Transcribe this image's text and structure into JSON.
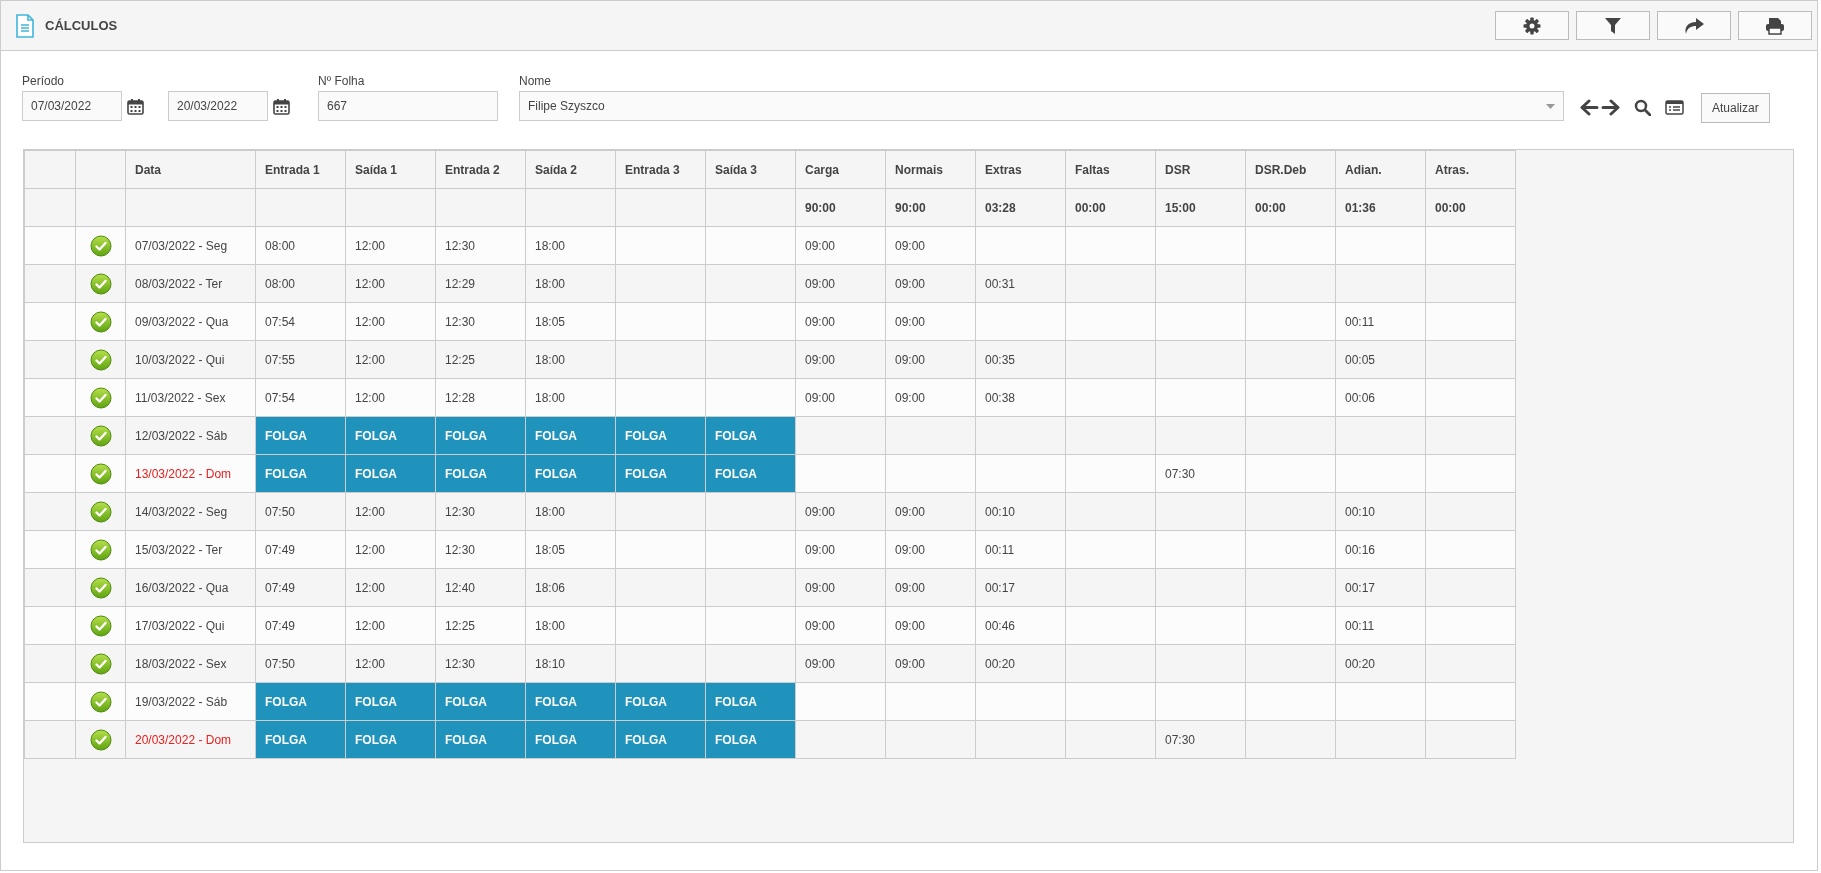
{
  "header": {
    "title": "CÁLCULOS"
  },
  "filters": {
    "period_label": "Período",
    "start_date": "07/03/2022",
    "end_date": "20/03/2022",
    "sheet_label": "Nº Folha",
    "sheet_number": "667",
    "name_label": "Nome",
    "name": "Filipe Szyszco",
    "refresh_button": "Atualizar"
  },
  "table": {
    "columns": [
      "Data",
      "Entrada 1",
      "Saída 1",
      "Entrada 2",
      "Saída 2",
      "Entrada 3",
      "Saída 3",
      "Carga",
      "Normais",
      "Extras",
      "Faltas",
      "DSR",
      "DSR.Deb",
      "Adian.",
      "Atras."
    ],
    "totals": [
      "90:00",
      "90:00",
      "03:28",
      "00:00",
      "15:00",
      "00:00",
      "01:36",
      "00:00"
    ],
    "rows": [
      {
        "date": "07/03/2022 - Seg",
        "sunday": false,
        "kind": "work",
        "punches": [
          "08:00",
          "12:00",
          "12:30",
          "18:00"
        ],
        "values": {
          "carga": "09:00",
          "normais": "09:00"
        }
      },
      {
        "date": "08/03/2022 - Ter",
        "sunday": false,
        "kind": "work",
        "punches": [
          "08:00",
          "12:00",
          "12:29",
          "18:00"
        ],
        "values": {
          "carga": "09:00",
          "normais": "09:00",
          "extras": "00:31"
        }
      },
      {
        "date": "09/03/2022 - Qua",
        "sunday": false,
        "kind": "work",
        "punches": [
          "07:54",
          "12:00",
          "12:30",
          "18:05"
        ],
        "values": {
          "carga": "09:00",
          "normais": "09:00",
          "adian": "00:11"
        }
      },
      {
        "date": "10/03/2022 - Qui",
        "sunday": false,
        "kind": "work",
        "punches": [
          "07:55",
          "12:00",
          "12:25",
          "18:00"
        ],
        "values": {
          "carga": "09:00",
          "normais": "09:00",
          "extras": "00:35",
          "adian": "00:05"
        }
      },
      {
        "date": "11/03/2022 - Sex",
        "sunday": false,
        "kind": "work",
        "punches": [
          "07:54",
          "12:00",
          "12:28",
          "18:00"
        ],
        "values": {
          "carga": "09:00",
          "normais": "09:00",
          "extras": "00:38",
          "adian": "00:06"
        }
      },
      {
        "date": "12/03/2022 - Sáb",
        "sunday": false,
        "kind": "day_off",
        "punches": [
          "FOLGA",
          "FOLGA",
          "FOLGA",
          "FOLGA",
          "FOLGA",
          "FOLGA"
        ],
        "values": {}
      },
      {
        "date": "13/03/2022 - Dom",
        "sunday": true,
        "kind": "day_off",
        "punches": [
          "FOLGA",
          "FOLGA",
          "FOLGA",
          "FOLGA",
          "FOLGA",
          "FOLGA"
        ],
        "values": {
          "dsr": "07:30"
        }
      },
      {
        "date": "14/03/2022 - Seg",
        "sunday": false,
        "kind": "work",
        "punches": [
          "07:50",
          "12:00",
          "12:30",
          "18:00"
        ],
        "values": {
          "carga": "09:00",
          "normais": "09:00",
          "extras": "00:10",
          "adian": "00:10"
        }
      },
      {
        "date": "15/03/2022 - Ter",
        "sunday": false,
        "kind": "work",
        "punches": [
          "07:49",
          "12:00",
          "12:30",
          "18:05"
        ],
        "values": {
          "carga": "09:00",
          "normais": "09:00",
          "extras": "00:11",
          "adian": "00:16"
        }
      },
      {
        "date": "16/03/2022 - Qua",
        "sunday": false,
        "kind": "work",
        "punches": [
          "07:49",
          "12:00",
          "12:40",
          "18:06"
        ],
        "values": {
          "carga": "09:00",
          "normais": "09:00",
          "extras": "00:17",
          "adian": "00:17"
        }
      },
      {
        "date": "17/03/2022 - Qui",
        "sunday": false,
        "kind": "work",
        "punches": [
          "07:49",
          "12:00",
          "12:25",
          "18:00"
        ],
        "values": {
          "carga": "09:00",
          "normais": "09:00",
          "extras": "00:46",
          "adian": "00:11"
        }
      },
      {
        "date": "18/03/2022 - Sex",
        "sunday": false,
        "kind": "work",
        "punches": [
          "07:50",
          "12:00",
          "12:30",
          "18:10"
        ],
        "values": {
          "carga": "09:00",
          "normais": "09:00",
          "extras": "00:20",
          "adian": "00:20"
        }
      },
      {
        "date": "19/03/2022 - Sáb",
        "sunday": false,
        "kind": "day_off",
        "punches": [
          "FOLGA",
          "FOLGA",
          "FOLGA",
          "FOLGA",
          "FOLGA",
          "FOLGA"
        ],
        "values": {}
      },
      {
        "date": "20/03/2022 - Dom",
        "sunday": true,
        "kind": "day_off",
        "punches": [
          "FOLGA",
          "FOLGA",
          "FOLGA",
          "FOLGA",
          "FOLGA",
          "FOLGA"
        ],
        "values": {
          "dsr": "07:30"
        }
      }
    ]
  }
}
